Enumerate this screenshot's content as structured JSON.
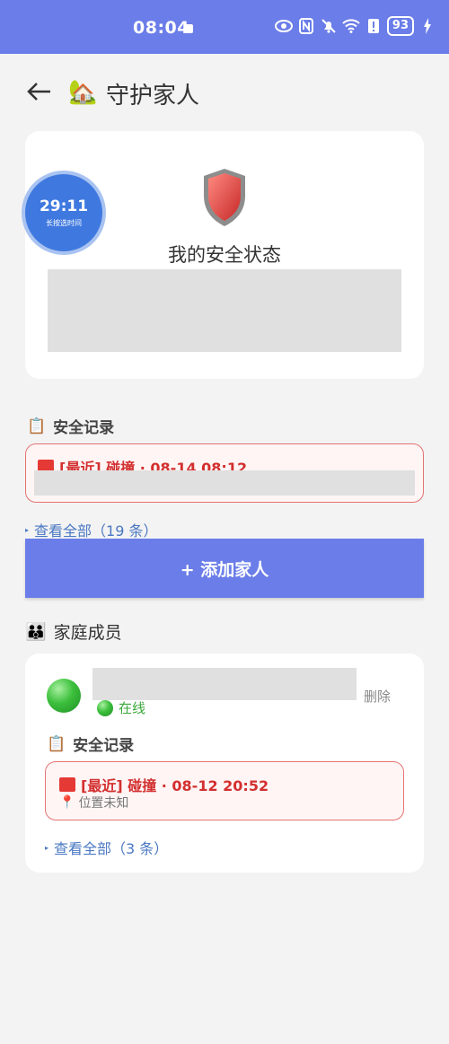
{
  "status_bar": {
    "time": "08:04",
    "battery": "93"
  },
  "header": {
    "title": "守护家人"
  },
  "status_card": {
    "timer_value": "29:11",
    "timer_hint": "长按选时间",
    "title": "我的安全状态"
  },
  "safety_section": {
    "title": "安全记录",
    "latest_record": "[最近] 碰撞 · 08-14 08:12",
    "see_all": "查看全部（19 条）"
  },
  "add_button": {
    "label": "+ 添加家人"
  },
  "family": {
    "title": "家庭成员",
    "member": {
      "delete_label": "删除",
      "status": "在线",
      "safety_title": "安全记录",
      "latest_record": "[最近] 碰撞 · 08-12 20:52",
      "location": "位置未知",
      "see_all": "查看全部（3 条）"
    }
  },
  "colors": {
    "accent": "#6b7de8",
    "alert_red": "#d32f2f",
    "online_green": "#3aa83a",
    "link_blue": "#4a78c2"
  }
}
